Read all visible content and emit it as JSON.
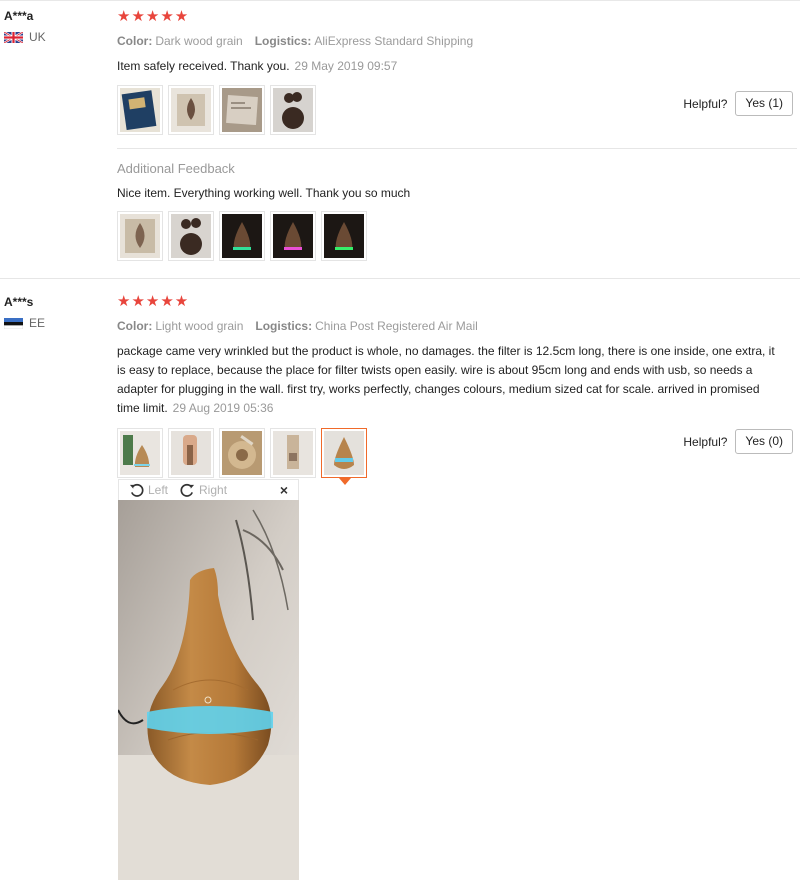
{
  "reviews": [
    {
      "user": "A***a",
      "country": "UK",
      "stars": "★★★★★",
      "color_label": "Color:",
      "color_value": "Dark wood grain",
      "logistics_label": "Logistics:",
      "logistics_value": "AliExpress Standard Shipping",
      "text": "Item safely received. Thank you.",
      "date": "29 May 2019 09:57",
      "helpful_label": "Helpful?",
      "yes_button": "Yes (1)",
      "additional": {
        "title": "Additional Feedback",
        "text": "Nice item. Everything working well. Thank you so much"
      }
    },
    {
      "user": "A***s",
      "country": "EE",
      "stars": "★★★★★",
      "color_label": "Color:",
      "color_value": "Light wood grain",
      "logistics_label": "Logistics:",
      "logistics_value": "China Post Registered Air Mail",
      "text": "package came very wrinkled but the product is whole, no damages. the filter is 12.5cm long, there is one inside, one extra, it is easy to replace, because the place for filter twists open easily. wire is about 95cm long and ends with usb, so needs a adapter for plugging in the wall. first try, works perfectly, changes colours, medium sized cat for scale. arrived in promised time limit.",
      "date": "29 Aug 2019 05:36",
      "helpful_label": "Helpful?",
      "yes_button": "Yes (0)"
    }
  ],
  "viewer": {
    "rotate_left": "Left",
    "rotate_right": "Right",
    "close": "×"
  },
  "colors": {
    "star": "#e8453c",
    "selected_border": "#f06a2a",
    "humidifier_glow": "#5fd3ee"
  }
}
